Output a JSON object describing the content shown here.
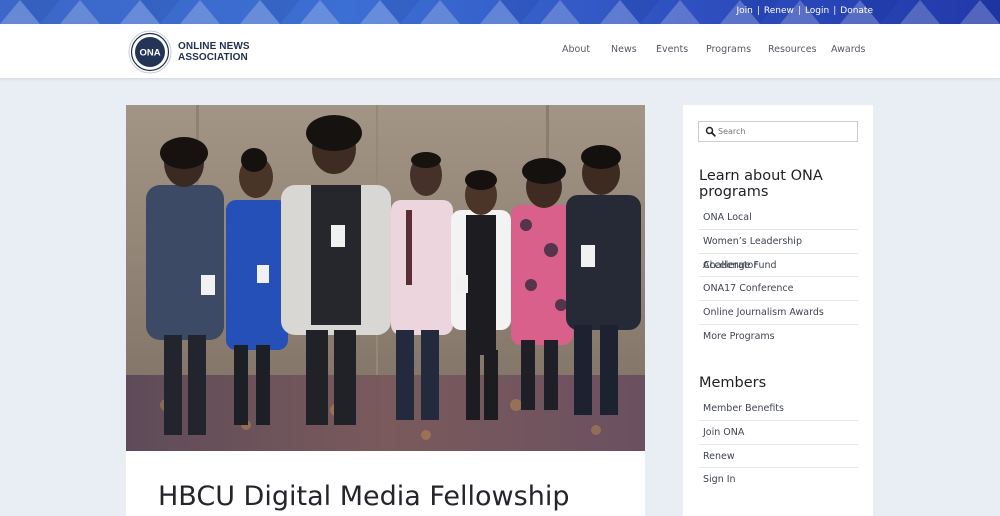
{
  "top_links": [
    "Join",
    "Renew",
    "Login",
    "Donate"
  ],
  "logo": {
    "badge": "ONA",
    "line1": "ONLINE NEWS",
    "line2": "ASSOCIATION"
  },
  "nav": [
    "About",
    "News",
    "Events",
    "Programs",
    "Resources",
    "Awards"
  ],
  "article": {
    "title": "HBCU Digital Media Fellowship"
  },
  "search": {
    "placeholder": "Search",
    "icon": "search-icon"
  },
  "sidebar": {
    "programs_heading": "Learn about ONA programs",
    "programs": [
      "ONA Local",
      "Women’s Leadership Accelerator",
      "Challenge Fund",
      "ONA17 Conference",
      "Online Journalism Awards",
      "More Programs"
    ],
    "members_heading": "Members",
    "members": [
      "Member Benefits",
      "Join ONA",
      "Renew",
      "Sign In"
    ]
  }
}
